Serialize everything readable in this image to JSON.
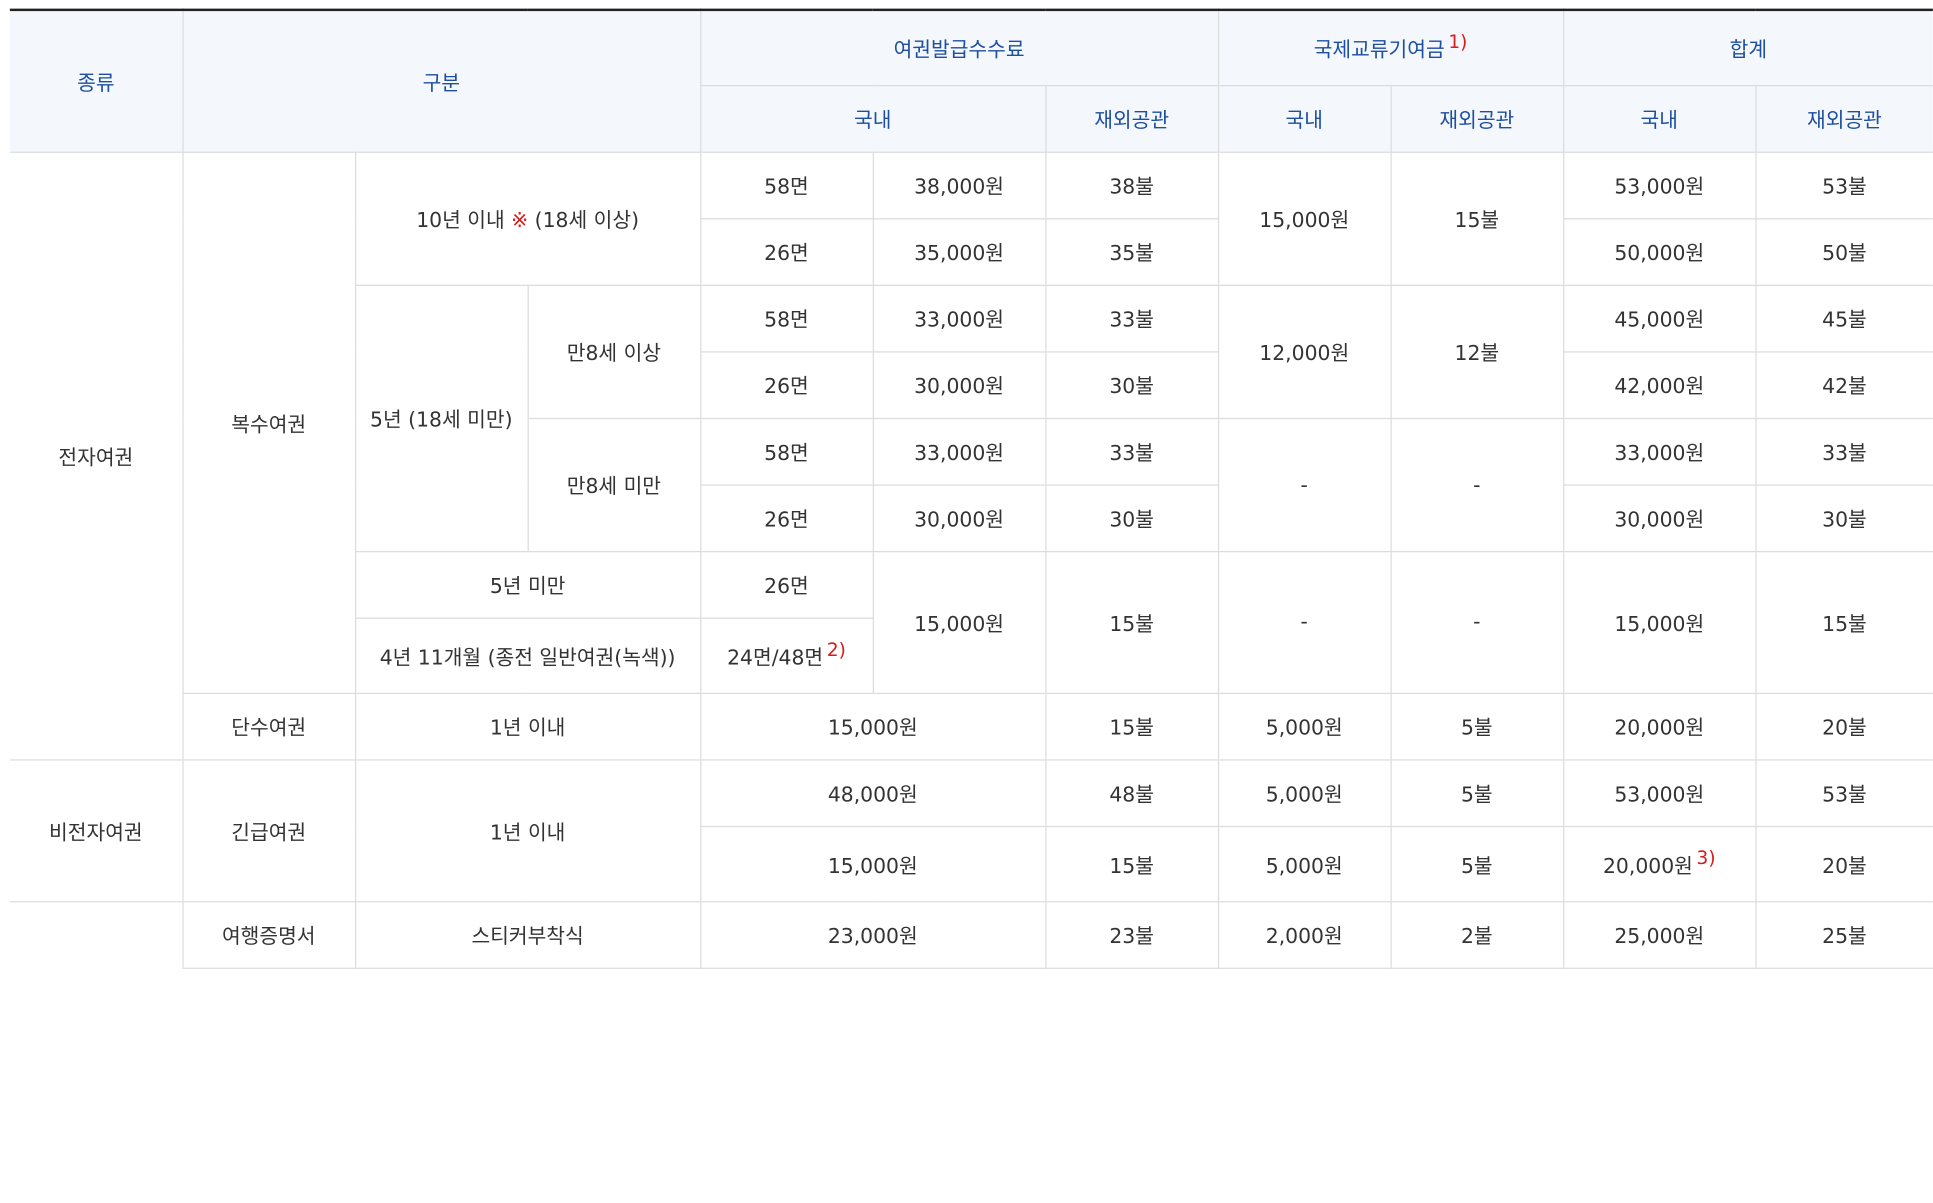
{
  "header": {
    "type": "종류",
    "category": "구분",
    "fee": "여권발급수수료",
    "intl": "국제교류기여금",
    "intl_note": "1)",
    "total": "합계",
    "domestic": "국내",
    "overseas": "재외공관"
  },
  "groups": {
    "electronic": "전자여권",
    "non_electronic": "비전자여권",
    "multi": "복수여권",
    "single": "단수여권",
    "emergency": "긴급여권",
    "travel_cert": "여행증명서"
  },
  "sub": {
    "ten_years": "10년 이내",
    "mark": "※",
    "ten_years_age": "(18세 이상)",
    "five_years": "5년 (18세 미만)",
    "age8_over": "만8세 이상",
    "age8_under": "만8세 미만",
    "under5": "5년 미만",
    "green": "4년 11개월 (종전 일반여권(녹색))",
    "one_year": "1년 이내",
    "sticker": "스티커부착식"
  },
  "pages": {
    "p58": "58면",
    "p26": "26면",
    "p24_48": "24면/48면",
    "p24_48_note": "2)"
  },
  "values": {
    "r1": [
      "38,000원",
      "38불",
      "15,000원",
      "15불",
      "53,000원",
      "53불"
    ],
    "r2": [
      "35,000원",
      "35불",
      "50,000원",
      "50불"
    ],
    "r3": [
      "33,000원",
      "33불",
      "12,000원",
      "12불",
      "45,000원",
      "45불"
    ],
    "r4": [
      "30,000원",
      "30불",
      "42,000원",
      "42불"
    ],
    "r5": [
      "33,000원",
      "33불",
      "-",
      "-",
      "33,000원",
      "33불"
    ],
    "r6": [
      "30,000원",
      "30불",
      "30,000원",
      "30불"
    ],
    "r7": [
      "15,000원",
      "15불",
      "-",
      "-",
      "15,000원",
      "15불"
    ],
    "r9": [
      "15,000원",
      "15불",
      "5,000원",
      "5불",
      "20,000원",
      "20불"
    ],
    "r10": [
      "48,000원",
      "48불",
      "5,000원",
      "5불",
      "53,000원",
      "53불"
    ],
    "r11": [
      "15,000원",
      "15불",
      "5,000원",
      "5불",
      "20,000원",
      "3)",
      "20불"
    ],
    "r12": [
      "23,000원",
      "23불",
      "2,000원",
      "2불",
      "25,000원",
      "25불"
    ]
  }
}
